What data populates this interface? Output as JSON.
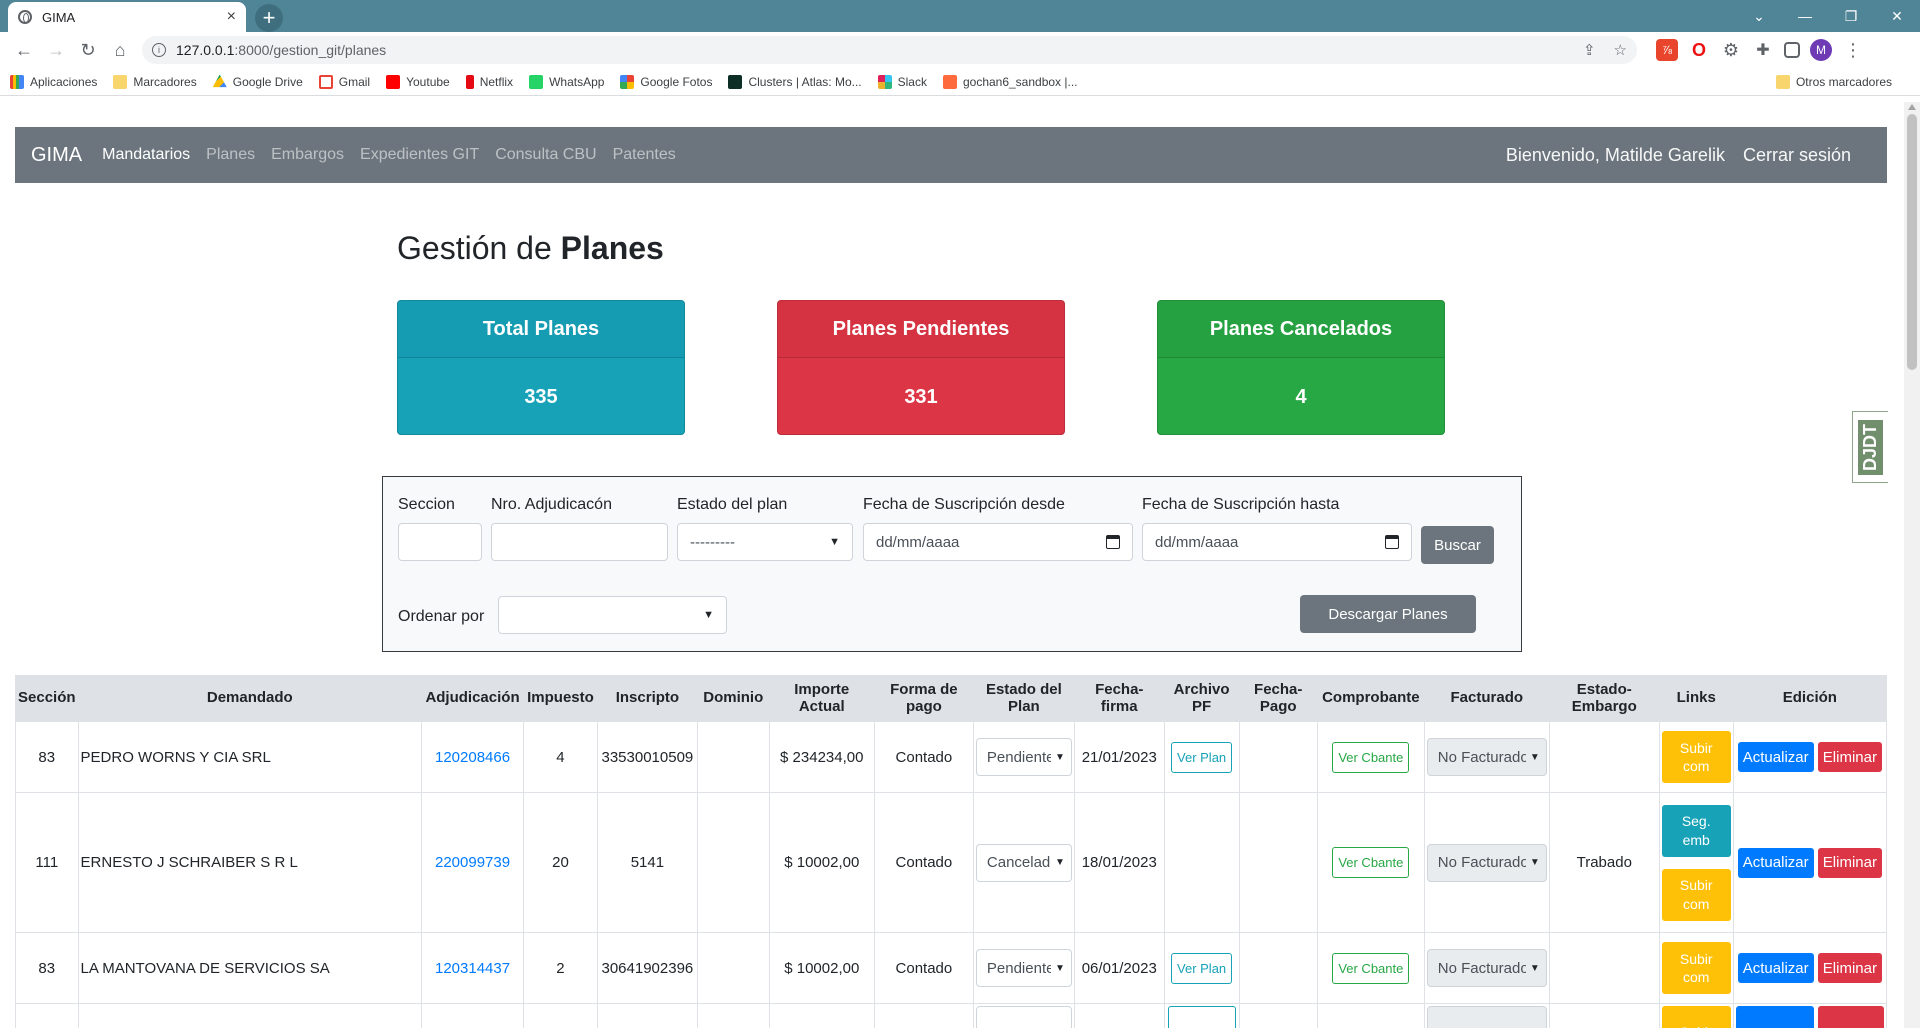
{
  "browser": {
    "tab_title": "GIMA",
    "tab_close": "×",
    "new_tab": "+",
    "url_host": "127.0.0.1",
    "url_rest": ":8000/gestion_git/planes",
    "avatar_letter": "M",
    "bookmarks": [
      "Aplicaciones",
      "Marcadores",
      "Google Drive",
      "Gmail",
      "Youtube",
      "Netflix",
      "WhatsApp",
      "Google Fotos",
      "Clusters | Atlas: Mo...",
      "Slack",
      "gochan6_sandbox |..."
    ],
    "other_bookmarks": "Otros marcadores"
  },
  "navbar": {
    "brand": "GIMA",
    "links": [
      "Mandatarios",
      "Planes",
      "Embargos",
      "Expedientes GIT",
      "Consulta CBU",
      "Patentes"
    ],
    "welcome": "Bienvenido, Matilde Garelik",
    "logout": "Cerrar sesión"
  },
  "page": {
    "title_prefix": "Gestión de ",
    "title_bold": "Planes"
  },
  "stats": [
    {
      "label": "Total Planes",
      "value": "335"
    },
    {
      "label": "Planes Pendientes",
      "value": "331"
    },
    {
      "label": "Planes Cancelados",
      "value": "4"
    }
  ],
  "filters": {
    "seccion_label": "Seccion",
    "seccion_value": "",
    "adjudicacion_label": "Nro. Adjudicacón",
    "adjudicacion_value": "",
    "estado_label": "Estado del plan",
    "estado_value": "---------",
    "desde_label": "Fecha de Suscripción desde",
    "desde_placeholder": "dd/mm/aaaa",
    "hasta_label": "Fecha de Suscripción hasta",
    "hasta_placeholder": "dd/mm/aaaa",
    "buscar": "Buscar",
    "ordenar_label": "Ordenar por",
    "ordenar_value": "",
    "descargar": "Descargar Planes"
  },
  "table": {
    "headers": [
      "Sección",
      "Demandado",
      "Adjudicación",
      "Impuesto",
      "Inscripto",
      "Dominio",
      "Importe Actual",
      "Forma de pago",
      "Estado del Plan",
      "Fecha-firma",
      "Archivo PF",
      "Fecha-Pago",
      "Comprobante",
      "Facturado",
      "Estado-Embargo",
      "Links",
      "Edición"
    ],
    "buttons": {
      "ver_plan": "Ver Plan",
      "ver_cbante": "Ver Cbante",
      "subir_com": "Subir com",
      "seg_emb": "Seg. emb",
      "actualizar": "Actualizar",
      "eliminar": "Eliminar"
    },
    "rows": [
      {
        "seccion": "83",
        "demandado": "PEDRO WORNS Y CIA SRL",
        "adjudicacion": "120208466",
        "impuesto": "4",
        "inscripto": "33530010509",
        "dominio": "",
        "importe": "$ 234234,00",
        "forma_pago": "Contado",
        "estado": "Pendiente",
        "fecha_firma": "21/01/2023",
        "archivo": "Ver Plan",
        "fecha_pago": "",
        "comprobante": "Ver Cbante",
        "facturado": "No Facturado",
        "embargo": ""
      },
      {
        "seccion": "111",
        "demandado": "ERNESTO J SCHRAIBER S R L",
        "adjudicacion": "220099739",
        "impuesto": "20",
        "inscripto": "5141",
        "dominio": "",
        "importe": "$ 10002,00",
        "forma_pago": "Contado",
        "estado": "Cancelado",
        "fecha_firma": "18/01/2023",
        "archivo": "",
        "fecha_pago": "",
        "comprobante": "Ver Cbante",
        "facturado": "No Facturado",
        "embargo": "Trabado"
      },
      {
        "seccion": "83",
        "demandado": "LA MANTOVANA DE SERVICIOS SA",
        "adjudicacion": "120314437",
        "impuesto": "2",
        "inscripto": "30641902396",
        "dominio": "",
        "importe": "$ 10002,00",
        "forma_pago": "Contado",
        "estado": "Pendiente",
        "fecha_firma": "06/01/2023",
        "archivo": "Ver Plan",
        "fecha_pago": "",
        "comprobante": "Ver Cbante",
        "facturado": "No Facturado",
        "embargo": ""
      }
    ],
    "partial_row": {
      "links": "Subir"
    }
  },
  "debug_toolbar": "DJDT"
}
